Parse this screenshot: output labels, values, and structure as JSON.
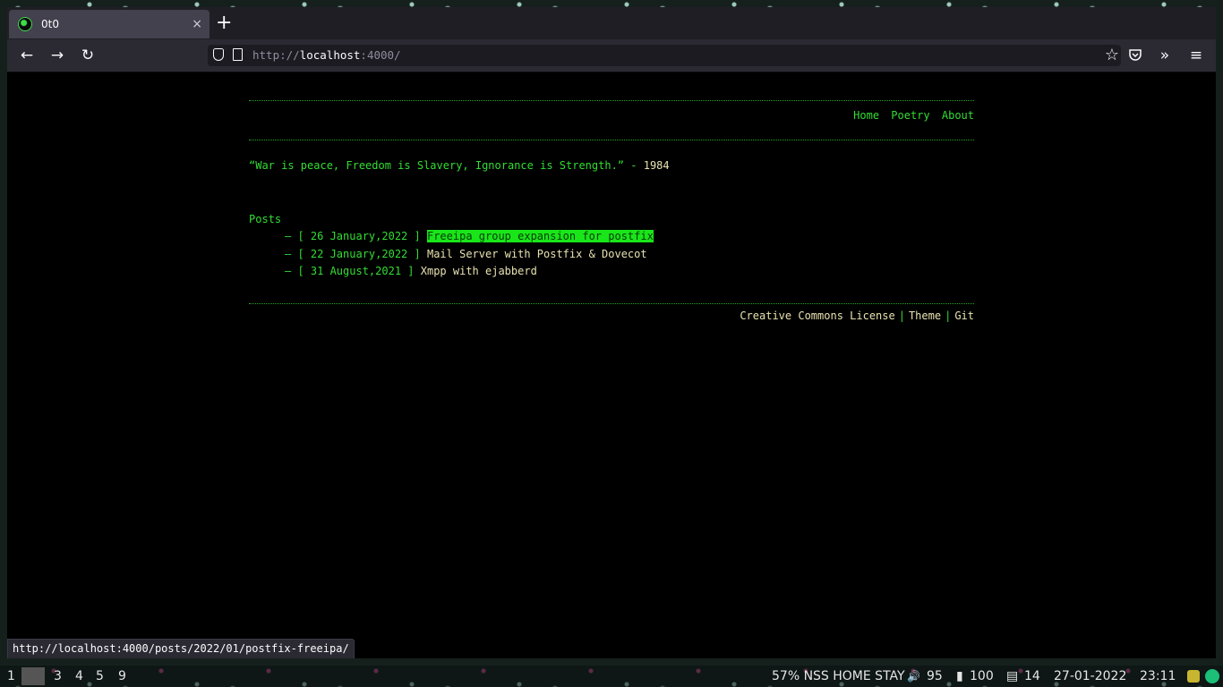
{
  "browser": {
    "tab_title": "0t0",
    "tab_close": "×",
    "new_tab": "+",
    "url_scheme": "http://",
    "url_host": "localhost",
    "url_rest": ":4000/",
    "star": "☆",
    "back": "←",
    "forward": "→",
    "reload": "↻",
    "overflow": "»",
    "menu": "≡",
    "status_url": "http://localhost:4000/posts/2022/01/postfix-freeipa/"
  },
  "site": {
    "nav": [
      "Home",
      "Poetry",
      "About"
    ],
    "quote": "“War is peace, Freedom is Slavery, Ignorance is Strength.” -",
    "quote_source": "1984",
    "posts_heading": "Posts",
    "posts": [
      {
        "date": "26 January,2022",
        "title": "Freeipa group expansion for postfix"
      },
      {
        "date": "22 January,2022",
        "title": "Mail Server with Postfix & Dovecot"
      },
      {
        "date": "31 August,2021",
        "title": "Xmpp with ejabberd"
      }
    ],
    "footer": {
      "license": "Creative Commons License",
      "sep": "|",
      "theme": "Theme",
      "git": "Git"
    }
  },
  "wm": {
    "workspaces": [
      "1",
      "3",
      "4",
      "5",
      "9"
    ],
    "network": "57% NSS HOME STAY",
    "volume_icon": "🔊",
    "volume": "95",
    "battery_icon": "▮",
    "battery": "100",
    "disk_icon": "▤",
    "disk": "14",
    "date": "27-01-2022",
    "time": "23:11"
  },
  "colors": {
    "accent_green": "#33dd33",
    "text_cream": "#e8e2b0",
    "page_bg": "#000000",
    "highlight": "#19e619"
  }
}
